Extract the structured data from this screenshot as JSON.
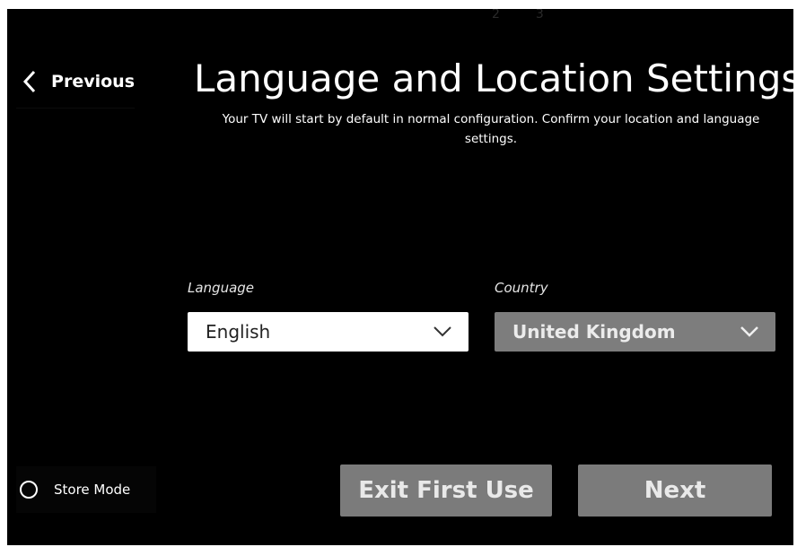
{
  "steps": [
    "2",
    "3"
  ],
  "nav": {
    "previous_label": "Previous"
  },
  "header": {
    "title": "Language and Location Settings",
    "subtitle": "Your TV will start by default in normal configuration. Confirm your location and language settings."
  },
  "language": {
    "label": "Language",
    "value": "English"
  },
  "country": {
    "label": "Country",
    "value": "United Kingdom"
  },
  "store_mode": {
    "label": "Store Mode",
    "selected": false
  },
  "buttons": {
    "exit_label": "Exit First Use",
    "next_label": "Next"
  },
  "colors": {
    "background": "#000000",
    "button_gray": "#7b7b7b",
    "text": "#ffffff"
  },
  "icons": {
    "previous": "chevron-left-icon",
    "dropdown": "chevron-down-icon",
    "radio": "radio-unchecked-icon"
  }
}
